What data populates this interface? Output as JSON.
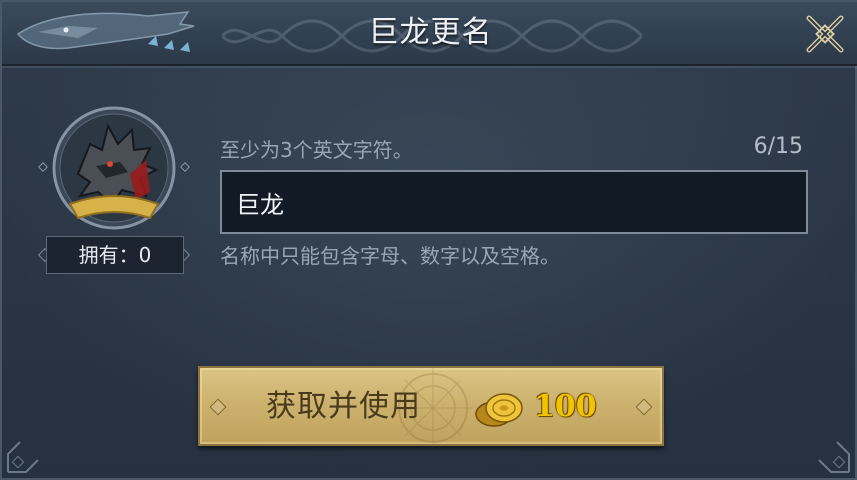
{
  "dialog": {
    "title": "巨龙更名",
    "close_icon": "close-x-icon"
  },
  "avatar": {
    "icon": "dragon-portrait-icon",
    "owned_label": "拥有：0"
  },
  "rename": {
    "hint_top": "至少为3个英文字符。",
    "counter": "6/15",
    "input_value": "巨龙",
    "hint_bottom": "名称中只能包含字母、数字以及空格。"
  },
  "buy_button": {
    "label": "获取并使用",
    "coin_icon": "gold-coin-icon",
    "price": "100"
  },
  "colors": {
    "panel_bg": "#2a3644",
    "button_gold": "#cdb26f",
    "price_yellow": "#f2c400"
  }
}
